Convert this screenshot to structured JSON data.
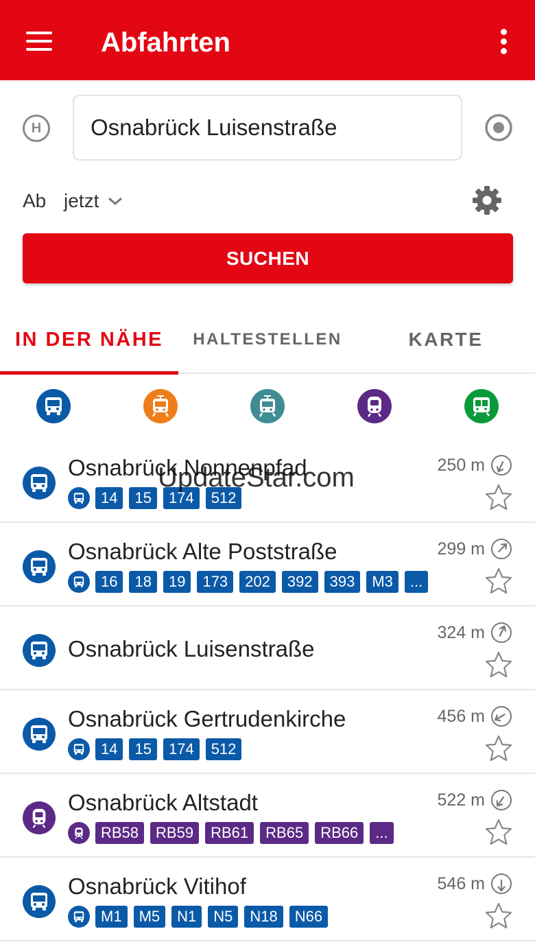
{
  "appbar": {
    "title": "Abfahrten"
  },
  "search": {
    "value": "Osnabrück Luisenstraße",
    "stop_symbol": "H"
  },
  "time": {
    "ab_label": "Ab",
    "selected": "jetzt"
  },
  "search_button": {
    "label": "SUCHEN"
  },
  "tabs": [
    {
      "label": "IN DER NÄHE",
      "active": true
    },
    {
      "label": "HALTESTELLEN",
      "active": false
    },
    {
      "label": "KARTE",
      "active": false
    }
  ],
  "filters": [
    {
      "mode": "bus",
      "color": "#0b5aa8"
    },
    {
      "mode": "tram",
      "color": "#ef7d1a"
    },
    {
      "mode": "tram",
      "color": "#3f8c93"
    },
    {
      "mode": "train",
      "color": "#5b2a86"
    },
    {
      "mode": "subway",
      "color": "#0a9a3a"
    }
  ],
  "colors": {
    "brand": "#e30613",
    "bus": "#0b5aa8",
    "train": "#5b2a86"
  },
  "stops": [
    {
      "name": "Osnabrück Nonnenpfad",
      "distance": "250 m",
      "mode": "bus",
      "lines": [
        "14",
        "15",
        "174",
        "512"
      ]
    },
    {
      "name": "Osnabrück Alte Poststraße",
      "distance": "299 m",
      "mode": "bus",
      "lines": [
        "16",
        "18",
        "19",
        "173",
        "202",
        "392",
        "393",
        "M3",
        "..."
      ]
    },
    {
      "name": "Osnabrück Luisenstraße",
      "distance": "324 m",
      "mode": "bus",
      "lines": []
    },
    {
      "name": "Osnabrück Gertrudenkirche",
      "distance": "456 m",
      "mode": "bus",
      "lines": [
        "14",
        "15",
        "174",
        "512"
      ]
    },
    {
      "name": "Osnabrück Altstadt",
      "distance": "522 m",
      "mode": "train",
      "lines": [
        "RB58",
        "RB59",
        "RB61",
        "RB65",
        "RB66",
        "..."
      ]
    },
    {
      "name": "Osnabrück Vitihof",
      "distance": "546 m",
      "mode": "bus",
      "lines": [
        "M1",
        "M5",
        "N1",
        "N5",
        "N18",
        "N66"
      ]
    }
  ],
  "watermark": "UpdateStar.com"
}
